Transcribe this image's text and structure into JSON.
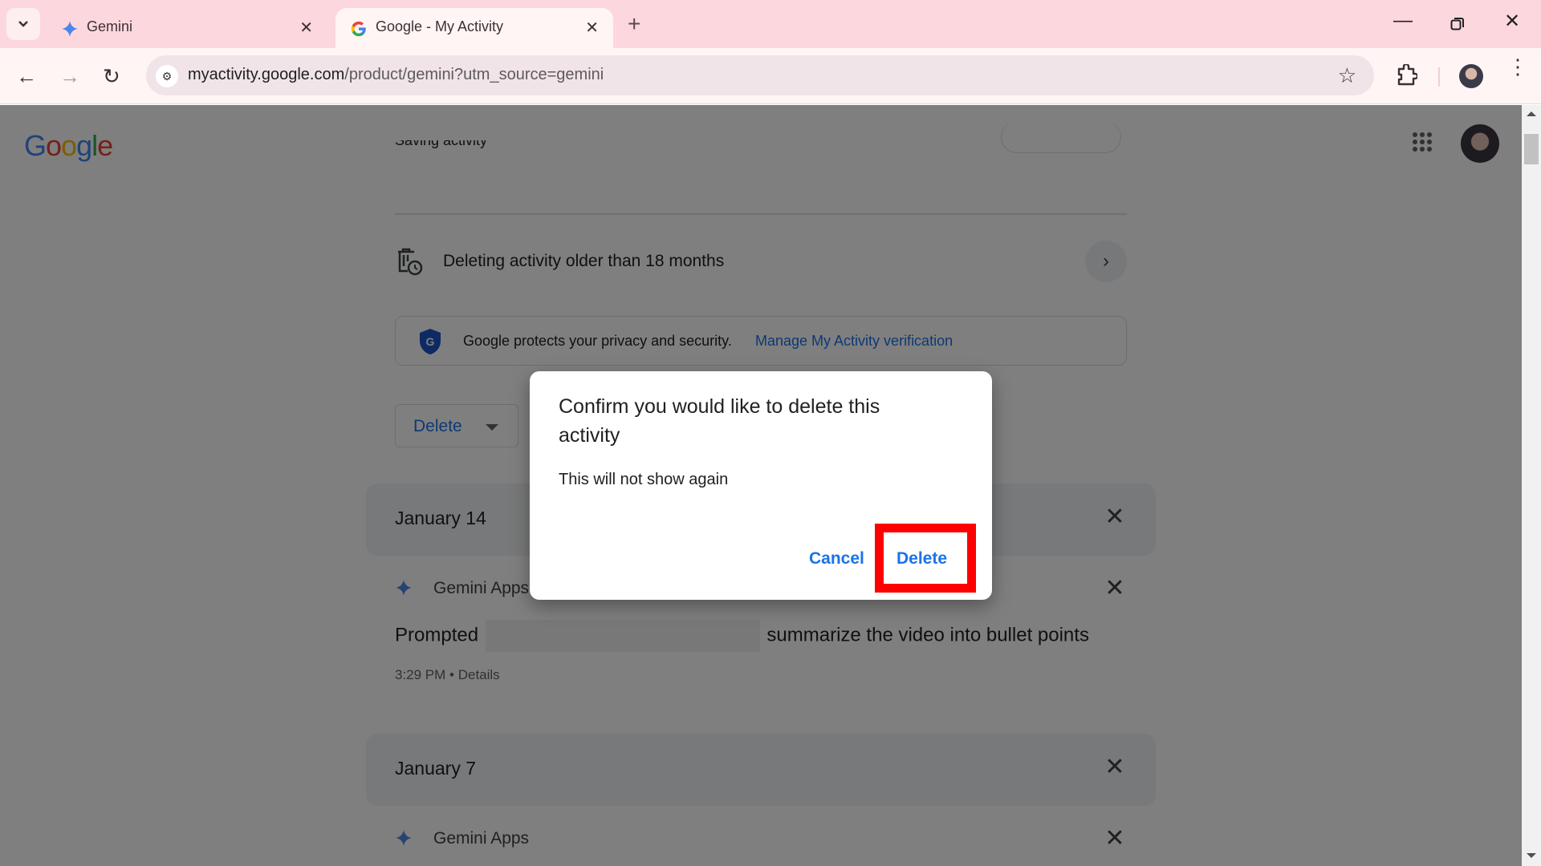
{
  "browser": {
    "tabs": [
      {
        "title": "Gemini",
        "active": false,
        "icon": "gemini-sparkle-icon"
      },
      {
        "title": "Google - My Activity",
        "active": true,
        "icon": "google-g-icon"
      }
    ],
    "url_host": "myactivity.google.com",
    "url_path": "/product/gemini?utm_source=gemini"
  },
  "page": {
    "logo": "Google",
    "saving_activity_label": "Saving activity",
    "auto_delete_label": "Deleting activity older than 18 months",
    "privacy_text": "Google protects your privacy and security.",
    "privacy_link": "Manage My Activity verification",
    "delete_dropdown_label": "Delete",
    "groups": [
      {
        "date": "January 14",
        "items": [
          {
            "app": "Gemini Apps",
            "prompt_prefix": "Prompted",
            "prompt_suffix": "summarize the video into bullet points",
            "time": "3:29 PM",
            "details_label": "Details"
          }
        ]
      },
      {
        "date": "January 7",
        "items": [
          {
            "app": "Gemini Apps"
          }
        ]
      }
    ]
  },
  "dialog": {
    "title": "Confirm you would like to delete this activity",
    "body": "This will not show again",
    "cancel_label": "Cancel",
    "confirm_label": "Delete",
    "highlight_color": "#ff0000"
  },
  "colors": {
    "accent": "#1a73e8",
    "tabstrip": "#fdd7de",
    "toolbar": "#fff5f4"
  }
}
